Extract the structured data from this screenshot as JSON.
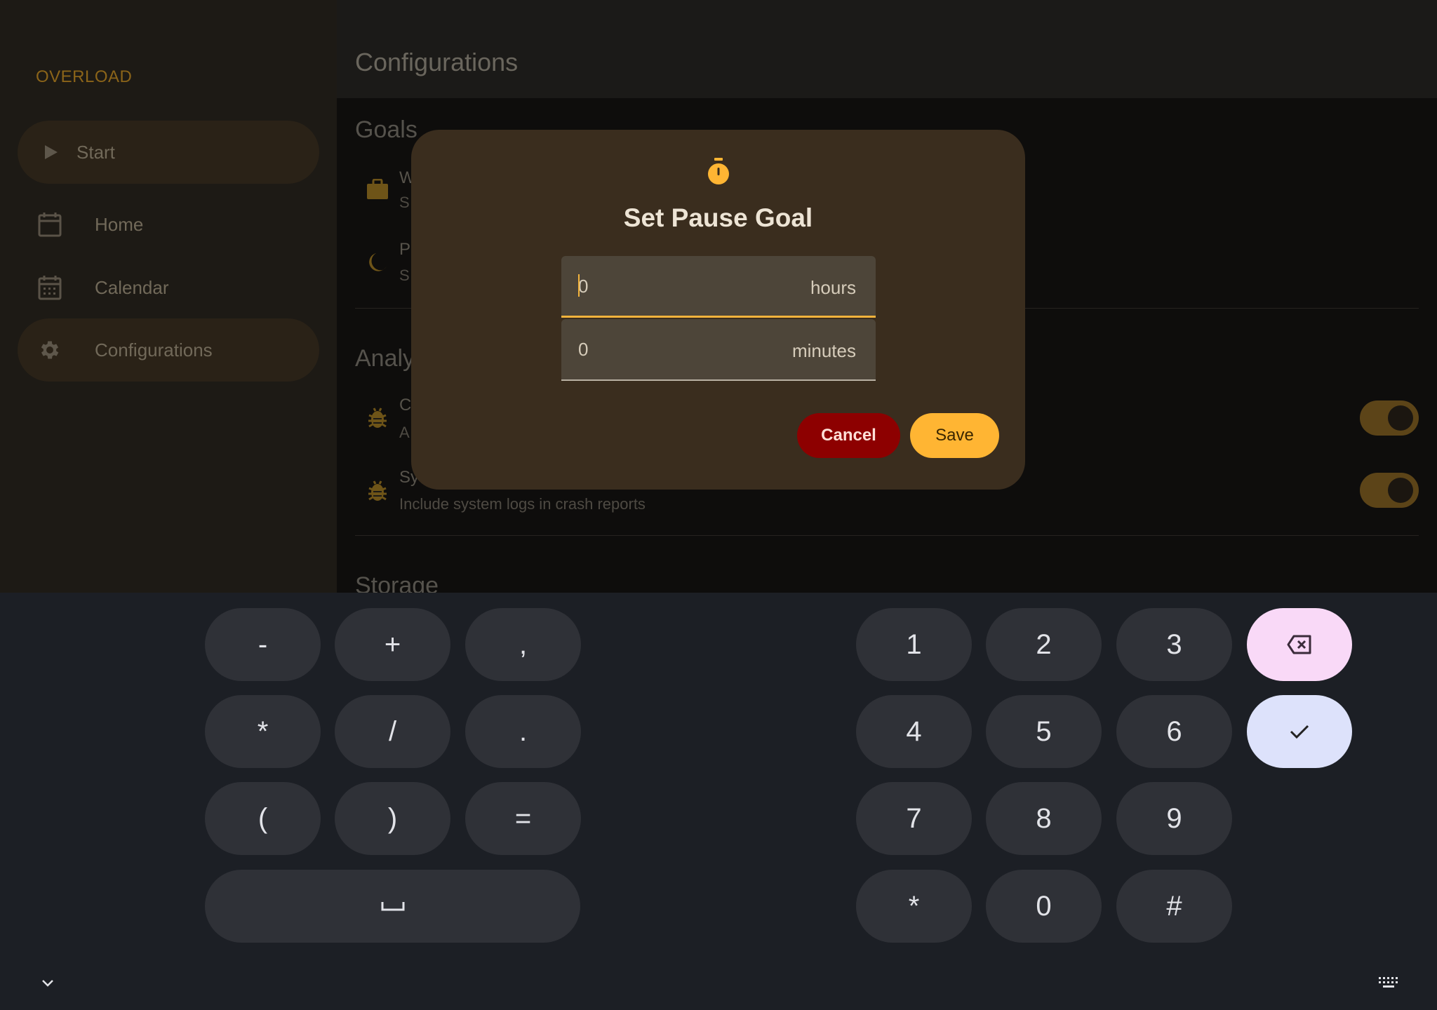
{
  "sidebar": {
    "brand": "OVERLOAD",
    "items": [
      {
        "label": "Start",
        "icon": "play-icon"
      },
      {
        "label": "Home",
        "icon": "calendar-blank-icon"
      },
      {
        "label": "Calendar",
        "icon": "calendar-grid-icon"
      },
      {
        "label": "Configurations",
        "icon": "gear-icon"
      }
    ]
  },
  "main": {
    "title": "Configurations",
    "goals_section": "Goals",
    "goals_rows": [
      {
        "title": "W",
        "sub": "S",
        "icon": "briefcase-icon"
      },
      {
        "title": "P",
        "sub": "S",
        "icon": "moon-icon"
      }
    ],
    "analytics_section": "Analy",
    "analytics_rows": [
      {
        "title": "C",
        "sub": "A",
        "icon": "bug-icon",
        "toggle": true
      },
      {
        "title": "Sys",
        "sub": "Include system logs in crash reports",
        "icon": "bug-icon",
        "toggle": true
      }
    ],
    "storage_section": "Storage"
  },
  "dialog": {
    "icon": "timer-icon",
    "title": "Set Pause Goal",
    "hours_value": "0",
    "hours_unit": "hours",
    "minutes_value": "0",
    "minutes_unit": "minutes",
    "cancel_label": "Cancel",
    "save_label": "Save"
  },
  "keyboard": {
    "symbols": [
      "-",
      "+",
      ",",
      "*",
      "/",
      ".",
      "(",
      ")",
      "="
    ],
    "space_label": "␣",
    "digits": [
      "1",
      "2",
      "3",
      "4",
      "5",
      "6",
      "7",
      "8",
      "9",
      "*",
      "0",
      "#"
    ],
    "backspace_icon": "backspace-icon",
    "enter_icon": "check-icon",
    "hide_icon": "chevron-down-icon",
    "switch_icon": "keyboard-icon"
  },
  "colors": {
    "accent": "#ffb533",
    "cancel": "#8d0000",
    "dialog_bg": "#3a2d1e",
    "keyboard_bg": "#1c1f25"
  }
}
